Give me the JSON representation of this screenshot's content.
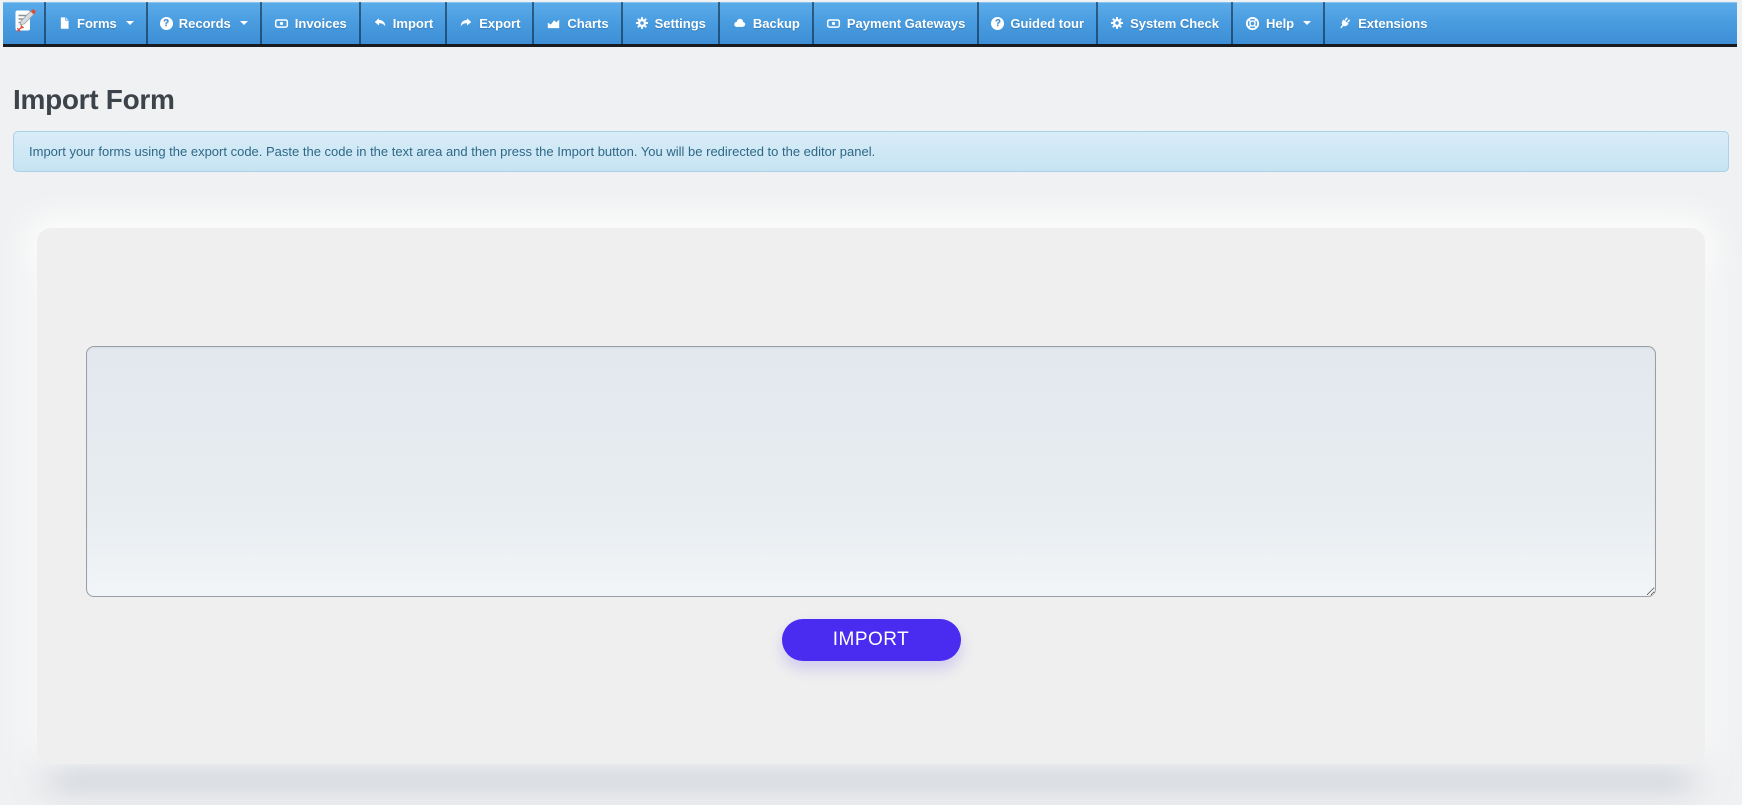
{
  "navbar": {
    "brand_icon": "form-pencil-logo",
    "items": [
      {
        "label": "Forms",
        "icon": "file-icon",
        "has_dropdown": true
      },
      {
        "label": "Records",
        "icon": "question-circle-icon",
        "has_dropdown": true
      },
      {
        "label": "Invoices",
        "icon": "money-bill-icon",
        "has_dropdown": false
      },
      {
        "label": "Import",
        "icon": "reply-arrow-icon",
        "has_dropdown": false
      },
      {
        "label": "Export",
        "icon": "share-arrow-icon",
        "has_dropdown": false
      },
      {
        "label": "Charts",
        "icon": "area-chart-icon",
        "has_dropdown": false
      },
      {
        "label": "Settings",
        "icon": "gear-icon",
        "has_dropdown": false
      },
      {
        "label": "Backup",
        "icon": "cloud-icon",
        "has_dropdown": false
      },
      {
        "label": "Payment Gateways",
        "icon": "money-bill-icon",
        "has_dropdown": false
      },
      {
        "label": "Guided tour",
        "icon": "question-circle-icon",
        "has_dropdown": false
      },
      {
        "label": "System Check",
        "icon": "gear-icon",
        "has_dropdown": false
      },
      {
        "label": "Help",
        "icon": "life-ring-icon",
        "has_dropdown": true
      },
      {
        "label": "Extensions",
        "icon": "plug-icon",
        "has_dropdown": false
      }
    ]
  },
  "page": {
    "title": "Import Form"
  },
  "alert": {
    "message": "Import your forms using the export code. Paste the code in the text area and then press the Import button. You will be redirected to the editor panel."
  },
  "import_form": {
    "textarea_value": "",
    "textarea_placeholder": "",
    "submit_label": "IMPORT"
  },
  "colors": {
    "navbar_top": "#5cacea",
    "navbar_bottom": "#3e8fd6",
    "navbar_border": "#191d21",
    "alert_bg": "#cfe7f6",
    "alert_border": "#aad1e7",
    "alert_text": "#2e6886",
    "title": "#3d434a",
    "button": "#4a2cf0",
    "page_bg": "#f0f1f2",
    "panel_bg": "#efefef",
    "textarea_bg": "#e6ebf0",
    "textarea_border": "#999fa6"
  }
}
